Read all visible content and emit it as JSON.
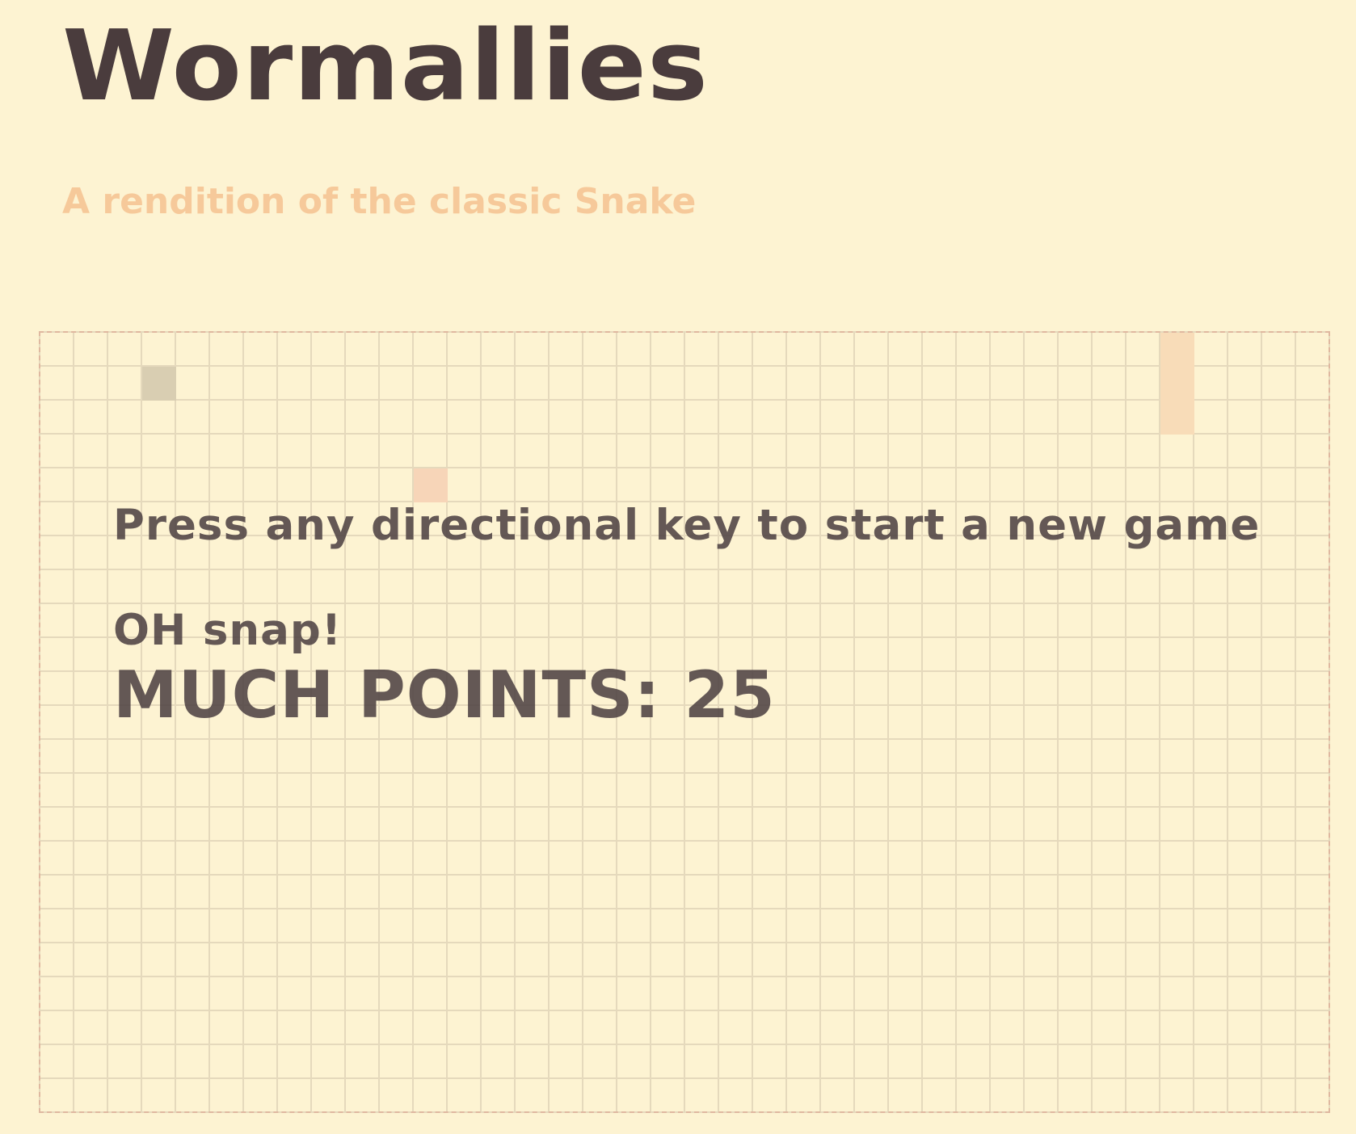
{
  "header": {
    "title": "Wormallies",
    "subtitle": "A rendition of the classic Snake"
  },
  "board": {
    "columns": 38,
    "rows": 23,
    "cells": [
      {
        "role": "worm",
        "col": 3,
        "row": 1,
        "color": "#d9ceb2"
      },
      {
        "role": "food",
        "col": 11,
        "row": 4,
        "color": "#f7d5b8"
      },
      {
        "role": "worm",
        "col": 33,
        "row": 0,
        "color": "#f8dcb8"
      },
      {
        "role": "worm",
        "col": 33,
        "row": 1,
        "color": "#f8dcb8"
      },
      {
        "role": "worm",
        "col": 33,
        "row": 2,
        "color": "#f8dcb8"
      }
    ]
  },
  "overlay": {
    "message": "Press any directional key to start a new game",
    "gameover": "OH snap!",
    "score_label": "MUCH POINTS: 25"
  },
  "colors": {
    "background": "#fdf3d2",
    "title": "#4a3c3d",
    "subtitle": "#f6c99a",
    "grid_line": "#e5d9bc",
    "board_border": "#dfb8a0",
    "overlay_text": "#4f4344"
  }
}
